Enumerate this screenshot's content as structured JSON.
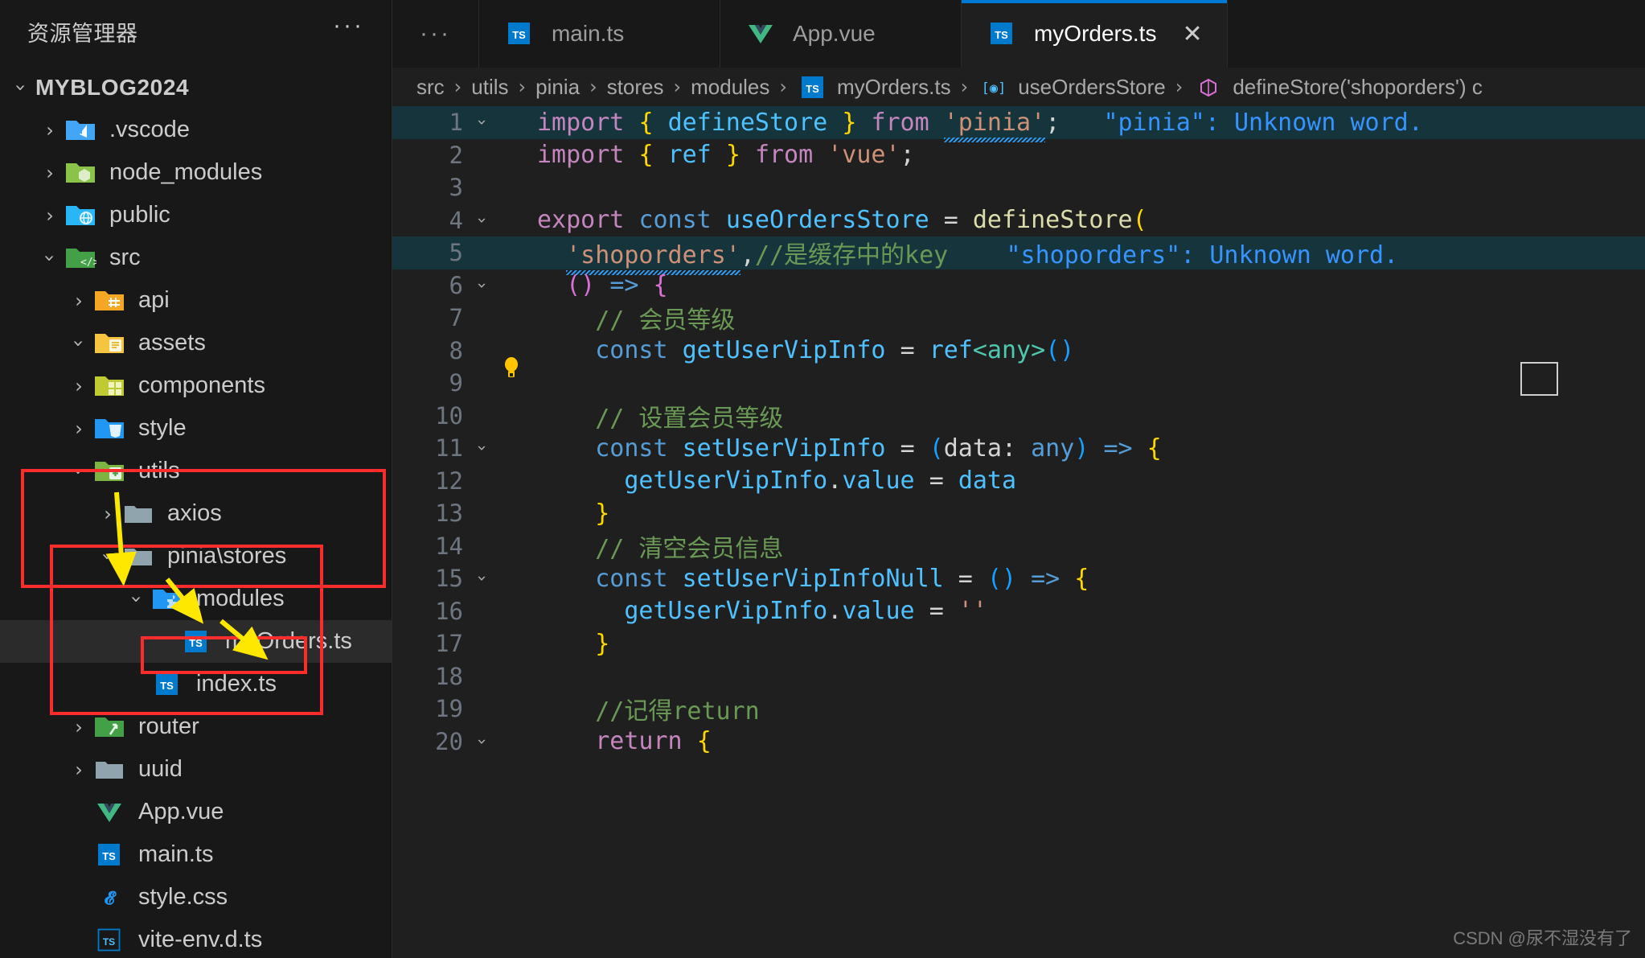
{
  "sidebar": {
    "title": "资源管理器",
    "more_label": "···",
    "root": {
      "label": "MYBLOG2024",
      "expanded": true
    },
    "items": [
      {
        "label": ".vscode",
        "depth": 1,
        "chevron": "closed",
        "icon": "vscode-folder-icon",
        "selected": false
      },
      {
        "label": "node_modules",
        "depth": 1,
        "chevron": "closed",
        "icon": "node-folder-icon",
        "selected": false
      },
      {
        "label": "public",
        "depth": 1,
        "chevron": "closed",
        "icon": "public-folder-icon",
        "selected": false
      },
      {
        "label": "src",
        "depth": 1,
        "chevron": "open",
        "icon": "src-folder-icon",
        "selected": false
      },
      {
        "label": "api",
        "depth": 2,
        "chevron": "closed",
        "icon": "api-folder-icon",
        "selected": false
      },
      {
        "label": "assets",
        "depth": 2,
        "chevron": "open",
        "icon": "assets-folder-icon",
        "selected": false
      },
      {
        "label": "components",
        "depth": 2,
        "chevron": "closed",
        "icon": "components-folder-icon",
        "selected": false
      },
      {
        "label": "style",
        "depth": 2,
        "chevron": "closed",
        "icon": "style-folder-icon",
        "selected": false
      },
      {
        "label": "utils",
        "depth": 2,
        "chevron": "open",
        "icon": "utils-folder-icon",
        "selected": false
      },
      {
        "label": "axios",
        "depth": 3,
        "chevron": "closed",
        "icon": "plain-folder-icon",
        "selected": false
      },
      {
        "label": "pinia\\stores",
        "depth": 3,
        "chevron": "open",
        "icon": "plain-folder-open-icon",
        "selected": false
      },
      {
        "label": "modules",
        "depth": 4,
        "chevron": "open",
        "icon": "modules-folder-icon",
        "selected": false
      },
      {
        "label": "myOrders.ts",
        "depth": 5,
        "chevron": "none",
        "icon": "ts-file-icon",
        "selected": true
      },
      {
        "label": "index.ts",
        "depth": 4,
        "chevron": "none",
        "icon": "ts-file-icon",
        "selected": false
      },
      {
        "label": "router",
        "depth": 2,
        "chevron": "closed",
        "icon": "router-folder-icon",
        "selected": false
      },
      {
        "label": "uuid",
        "depth": 2,
        "chevron": "closed",
        "icon": "plain-folder-icon",
        "selected": false
      },
      {
        "label": "App.vue",
        "depth": 2,
        "chevron": "none",
        "icon": "vue-file-icon",
        "selected": false
      },
      {
        "label": "main.ts",
        "depth": 2,
        "chevron": "none",
        "icon": "ts-file-icon",
        "selected": false
      },
      {
        "label": "style.css",
        "depth": 2,
        "chevron": "none",
        "icon": "css-file-icon",
        "selected": false
      },
      {
        "label": "vite-env.d.ts",
        "depth": 2,
        "chevron": "none",
        "icon": "ts-def-file-icon",
        "selected": false
      }
    ]
  },
  "tabs": {
    "overflow_label": "···",
    "items": [
      {
        "label": "main.ts",
        "icon": "ts-file-icon",
        "active": false,
        "closable": false
      },
      {
        "label": "App.vue",
        "icon": "vue-file-icon",
        "active": false,
        "closable": false
      },
      {
        "label": "myOrders.ts",
        "icon": "ts-file-icon",
        "active": true,
        "closable": true
      }
    ],
    "close_label": "✕"
  },
  "breadcrumb": {
    "separator": "›",
    "items": [
      {
        "label": "src",
        "icon": "none"
      },
      {
        "label": "utils",
        "icon": "none"
      },
      {
        "label": "pinia",
        "icon": "none"
      },
      {
        "label": "stores",
        "icon": "none"
      },
      {
        "label": "modules",
        "icon": "none"
      },
      {
        "label": "myOrders.ts",
        "icon": "ts-file-icon"
      },
      {
        "label": "useOrdersStore",
        "icon": "variable-symbol-icon"
      },
      {
        "label": "defineStore('shoporders') c",
        "icon": "object-symbol-icon"
      }
    ]
  },
  "editor": {
    "lamp_line": 8,
    "lines": [
      {
        "n": 1,
        "fold": "open",
        "highlight": true
      },
      {
        "n": 2,
        "fold": "none",
        "highlight": false
      },
      {
        "n": 3,
        "fold": "none",
        "highlight": false
      },
      {
        "n": 4,
        "fold": "open",
        "highlight": false
      },
      {
        "n": 5,
        "fold": "none",
        "highlight": true
      },
      {
        "n": 6,
        "fold": "open",
        "highlight": false
      },
      {
        "n": 7,
        "fold": "none",
        "highlight": false
      },
      {
        "n": 8,
        "fold": "none",
        "highlight": false
      },
      {
        "n": 9,
        "fold": "none",
        "highlight": false
      },
      {
        "n": 10,
        "fold": "none",
        "highlight": false
      },
      {
        "n": 11,
        "fold": "open",
        "highlight": false
      },
      {
        "n": 12,
        "fold": "none",
        "highlight": false
      },
      {
        "n": 13,
        "fold": "none",
        "highlight": false
      },
      {
        "n": 14,
        "fold": "none",
        "highlight": false
      },
      {
        "n": 15,
        "fold": "open",
        "highlight": false
      },
      {
        "n": 16,
        "fold": "none",
        "highlight": false
      },
      {
        "n": 17,
        "fold": "none",
        "highlight": false
      },
      {
        "n": 18,
        "fold": "none",
        "highlight": false
      },
      {
        "n": 19,
        "fold": "none",
        "highlight": false
      },
      {
        "n": 20,
        "fold": "open",
        "highlight": false
      }
    ],
    "code": {
      "l1": "import { defineStore } from 'pinia';",
      "l1_hint": "\"pinia\": Unknown word.",
      "l2": "import { ref } from 'vue';",
      "l3": "",
      "l4": "export const useOrdersStore = defineStore(",
      "l5": "'shoporders',//是缓存中的key",
      "l5_hint": "\"shoporders\": Unknown word.",
      "l6": "() => {",
      "l7": "// 会员等级",
      "l8": "const getUserVipInfo = ref<any>()",
      "l9": "",
      "l10": "// 设置会员等级",
      "l11": "const setUserVipInfo = (data: any) => {",
      "l12": "getUserVipInfo.value = data",
      "l13": "}",
      "l14": "// 清空会员信息",
      "l15": "const setUserVipInfoNull = () => {",
      "l16": "getUserVipInfo.value = ''",
      "l17": "}",
      "l18": "",
      "l19": "//记得return",
      "l20": "return {"
    }
  },
  "annotations": {
    "outer_box_label": "utils-folder-highlight",
    "inner_box_label": "pinia-stores-highlight",
    "file_box_label": "myOrders-file-highlight",
    "arrow1_label": "utils-to-pinia-arrow",
    "arrow2_label": "pinia-to-modules-arrow",
    "arrow3_label": "modules-to-myOrders-arrow",
    "box_color": "#fb2c2c",
    "arrow_color": "#ffe800"
  },
  "watermark": {
    "text": "CSDN @尿不湿没有了"
  }
}
